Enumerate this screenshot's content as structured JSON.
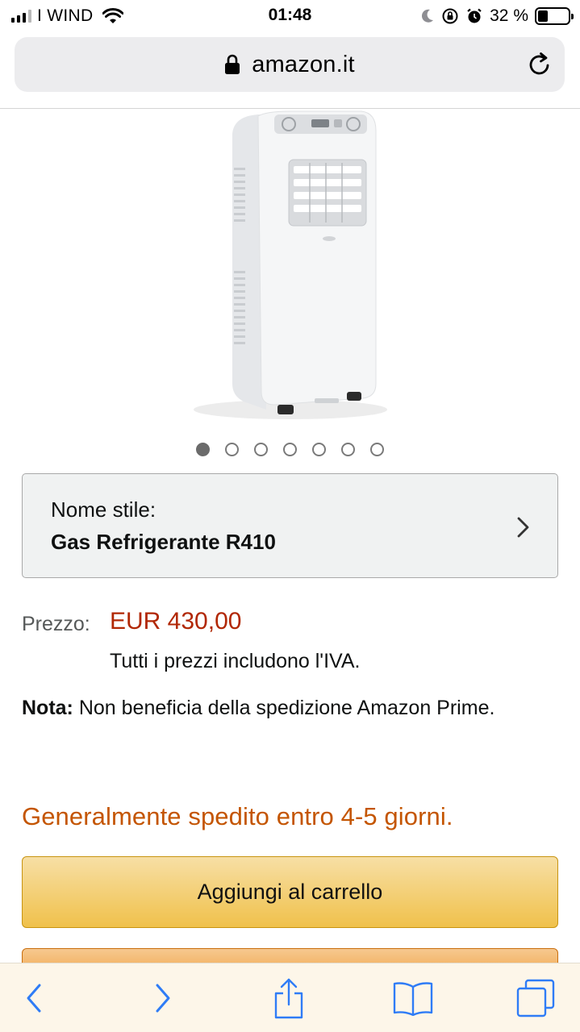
{
  "status_bar": {
    "carrier": "I WIND",
    "time": "01:48",
    "battery_percent": "32 %",
    "battery_level": 0.32
  },
  "browser": {
    "domain": "amazon.it"
  },
  "carousel": {
    "dot_count": 7,
    "active_index": 0
  },
  "style_selector": {
    "label": "Nome stile:",
    "value": "Gas Refrigerante R410"
  },
  "price": {
    "label": "Prezzo:",
    "value": "EUR 430,00",
    "vat_note": "Tutti i prezzi includono l'IVA."
  },
  "shipping_note": {
    "bold": "Nota:",
    "text": " Non beneficia della spedizione Amazon Prime."
  },
  "availability": "Generalmente spedito entro 4-5 giorni.",
  "buttons": {
    "add_to_cart": "Aggiungi al carrello"
  },
  "colors": {
    "price": "#b12704",
    "availability": "#c45500",
    "cart_button": "#f0c14b",
    "buy_button": "#ed9220",
    "toolbar_icons": "#2f7cf6"
  },
  "icons": {
    "toolbar": [
      "back-icon",
      "forward-icon",
      "share-icon",
      "bookmarks-icon",
      "tabs-icon"
    ]
  }
}
